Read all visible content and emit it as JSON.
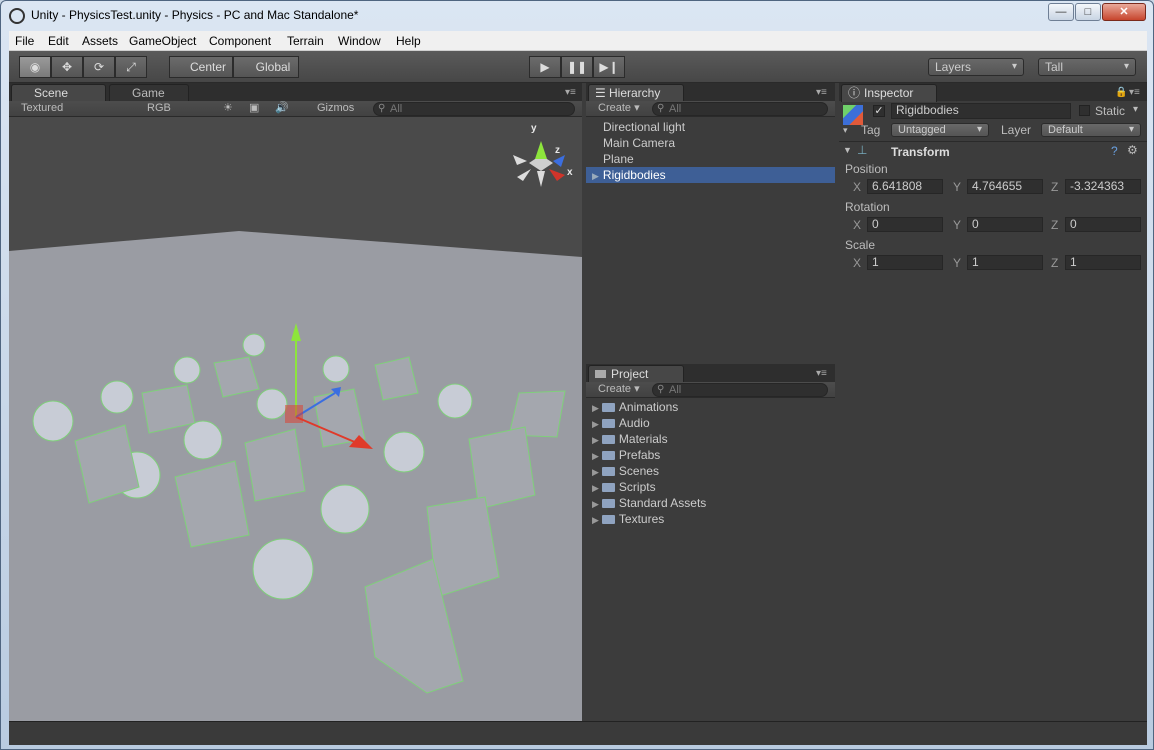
{
  "window": {
    "title": "Unity - PhysicsTest.unity - Physics - PC and Mac Standalone*",
    "min": "—",
    "max": "□",
    "close": "✕"
  },
  "menu": [
    "File",
    "Edit",
    "Assets",
    "GameObject",
    "Component",
    "Terrain",
    "Window",
    "Help"
  ],
  "toolbar": {
    "pivot": "Center",
    "space": "Global",
    "play_icon": "play-icon",
    "pause_icon": "pause-icon",
    "step_icon": "step-icon",
    "layers": "Layers",
    "layout": "Tall"
  },
  "scene": {
    "tab_scene": "Scene",
    "tab_game": "Game",
    "render_mode": "Textured",
    "channel": "RGB",
    "gizmos": "Gizmos",
    "search": "All",
    "gizmo_y": "y",
    "gizmo_x": "x",
    "gizmo_z": "z"
  },
  "hierarchy": {
    "tab": "Hierarchy",
    "create": "Create",
    "search": "All",
    "items": [
      "Directional light",
      "Main Camera",
      "Plane",
      "Rigidbodies"
    ],
    "selected": "Rigidbodies"
  },
  "project": {
    "tab": "Project",
    "create": "Create",
    "search": "All",
    "folders": [
      "Animations",
      "Audio",
      "Materials",
      "Prefabs",
      "Scenes",
      "Scripts",
      "Standard Assets",
      "Textures"
    ]
  },
  "inspector": {
    "tab": "Inspector",
    "name": "Rigidbodies",
    "static": "Static",
    "tag_label": "Tag",
    "tag": "Untagged",
    "layer_label": "Layer",
    "layer": "Default",
    "component": "Transform",
    "position_label": "Position",
    "position": {
      "x": "6.641808",
      "y": "4.764655",
      "z": "-3.324363"
    },
    "rotation_label": "Rotation",
    "rotation": {
      "x": "0",
      "y": "0",
      "z": "0"
    },
    "scale_label": "Scale",
    "scale": {
      "x": "1",
      "y": "1",
      "z": "1"
    },
    "axis": {
      "x": "X",
      "y": "Y",
      "z": "Z"
    }
  },
  "colors": {
    "selection": "#3e5f96",
    "panel": "#454545",
    "floor": "#9a9ca3",
    "sky": "#4a4a4a"
  }
}
